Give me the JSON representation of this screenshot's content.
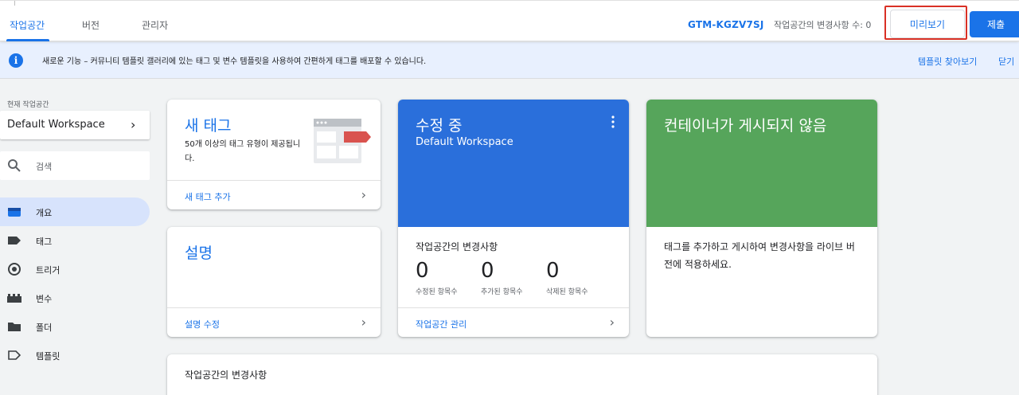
{
  "topbar": {
    "tabs": [
      {
        "label": "작업공간",
        "active": true
      },
      {
        "label": "버전",
        "active": false
      },
      {
        "label": "관리자",
        "active": false
      }
    ],
    "container_id": "GTM-KGZV7SJ",
    "changes_count": "작업공간의 변경사항 수: 0",
    "preview_label": "미리보기",
    "submit_label": "제출"
  },
  "banner": {
    "icon": "info-icon",
    "message": "새로운 기능 – 커뮤니티 템플릿 갤러리에 있는 태그 및 변수 템플릿을 사용하여 간편하게 태그를 배포할 수 있습니다.",
    "link_templates": "템플릿 찾아보기",
    "link_close": "닫기"
  },
  "sidebar": {
    "workspace_label": "현재 작업공간",
    "workspace_name": "Default Workspace",
    "search_placeholder": "검색",
    "items": [
      {
        "label": "개요",
        "icon": "overview-icon",
        "active": true
      },
      {
        "label": "태그",
        "icon": "tag-icon",
        "active": false
      },
      {
        "label": "트리거",
        "icon": "trigger-icon",
        "active": false
      },
      {
        "label": "변수",
        "icon": "variable-icon",
        "active": false
      },
      {
        "label": "폴더",
        "icon": "folder-icon",
        "active": false
      },
      {
        "label": "템플릿",
        "icon": "template-icon",
        "active": false
      }
    ]
  },
  "cards": {
    "new_tag": {
      "title": "새 태그",
      "description": "50개 이상의 태그 유형이 제공됩니다.",
      "footer_link": "새 태그 추가"
    },
    "description": {
      "title": "설명",
      "footer_link": "설명 수정"
    },
    "editing": {
      "title": "수정 중",
      "workspace": "Default Workspace",
      "changes_label": "작업공간의 변경사항",
      "stats": [
        {
          "value": "0",
          "label": "수정된 항목수"
        },
        {
          "value": "0",
          "label": "추가된 항목수"
        },
        {
          "value": "0",
          "label": "삭제된 항목수"
        }
      ],
      "footer_link": "작업공간 관리"
    },
    "not_published": {
      "title": "컨테이너가 게시되지 않음",
      "body": "태그를 추가하고 게시하여 변경사항을 라이브 버전에 적용하세요."
    },
    "workspace_changes": {
      "title": "작업공간의 변경사항"
    }
  },
  "colors": {
    "accent": "#1a73e8",
    "editing_card": "#2a6fdb",
    "not_published_card": "#56a55b",
    "highlight": "#d93025"
  }
}
